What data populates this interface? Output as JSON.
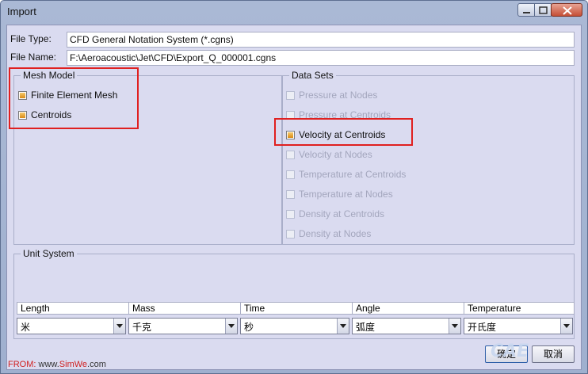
{
  "window": {
    "title": "Import"
  },
  "file": {
    "type_label": "File Type:",
    "type_value": "CFD General Notation System (*.cgns)",
    "name_label": "File Name:",
    "name_value": "F:\\Aeroacoustic\\Jet\\CFD\\Export_Q_000001.cgns"
  },
  "mesh_model": {
    "title": "Mesh Model",
    "items": [
      {
        "label": "Finite Element Mesh",
        "checked": true,
        "enabled": true
      },
      {
        "label": "Centroids",
        "checked": true,
        "enabled": true
      }
    ]
  },
  "data_sets": {
    "title": "Data Sets",
    "items": [
      {
        "label": "Pressure at Nodes",
        "checked": false,
        "enabled": false
      },
      {
        "label": "Pressure at Centroids",
        "checked": false,
        "enabled": false
      },
      {
        "label": "Velocity at Centroids",
        "checked": true,
        "enabled": true
      },
      {
        "label": "Velocity at Nodes",
        "checked": false,
        "enabled": false
      },
      {
        "label": "Temperature at Centroids",
        "checked": false,
        "enabled": false
      },
      {
        "label": "Temperature at Nodes",
        "checked": false,
        "enabled": false
      },
      {
        "label": "Density at Centroids",
        "checked": false,
        "enabled": false
      },
      {
        "label": "Density at Nodes",
        "checked": false,
        "enabled": false
      }
    ]
  },
  "unit_system": {
    "title": "Unit System",
    "columns": [
      {
        "header": "Length",
        "value": "米"
      },
      {
        "header": "Mass",
        "value": "千克"
      },
      {
        "header": "Time",
        "value": "秒"
      },
      {
        "header": "Angle",
        "value": "弧度"
      },
      {
        "header": "Temperature",
        "value": "开氏度"
      }
    ]
  },
  "buttons": {
    "ok": "确定",
    "cancel": "取消"
  },
  "source": {
    "prefix": "FROM:",
    "text_a": " www.",
    "text_b": "SimWe",
    "text_c": ".com"
  },
  "watermark": "CAE",
  "colors": {
    "highlight": "#e02020",
    "checked": "#e8a22a",
    "background": "#dadbf0"
  }
}
